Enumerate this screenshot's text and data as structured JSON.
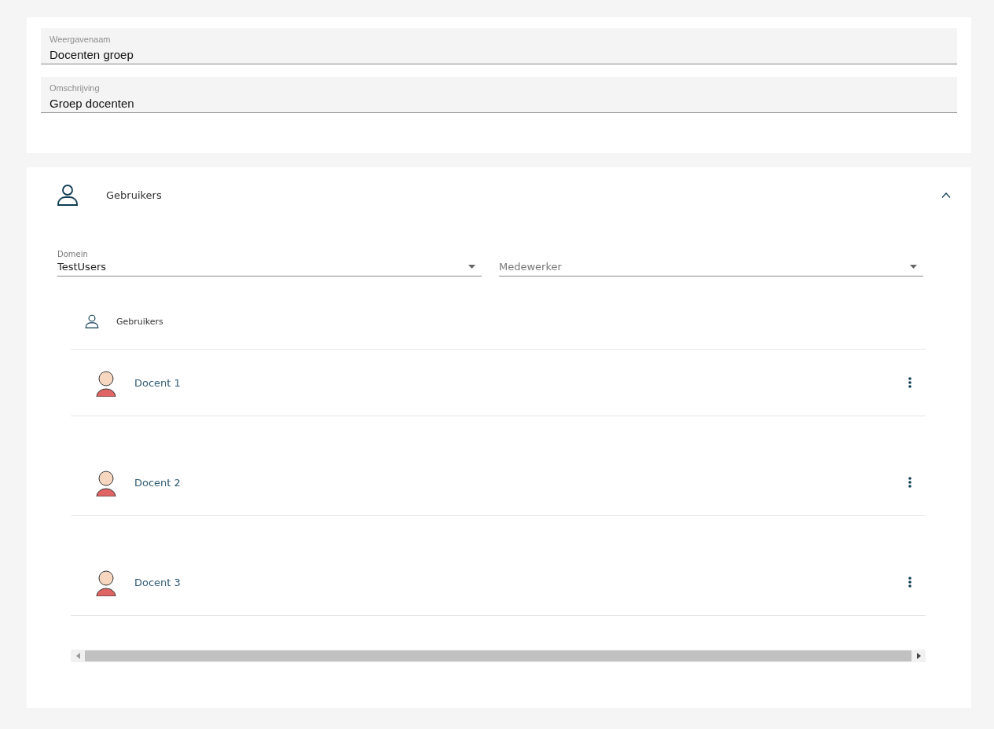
{
  "details": {
    "fields": [
      {
        "label": "Weergavenaam",
        "value": "Docenten groep"
      },
      {
        "label": "Omschrijving",
        "value": "Groep docenten"
      }
    ]
  },
  "users_panel": {
    "title": "Gebruikers",
    "expanded": true,
    "domain_select": {
      "label": "Domein",
      "value": "TestUsers"
    },
    "employee_select": {
      "placeholder": "Medewerker"
    },
    "list": {
      "header": "Gebruikers",
      "rows": [
        {
          "name": "Docent 1"
        },
        {
          "name": "Docent 2"
        },
        {
          "name": "Docent 3"
        }
      ]
    }
  }
}
